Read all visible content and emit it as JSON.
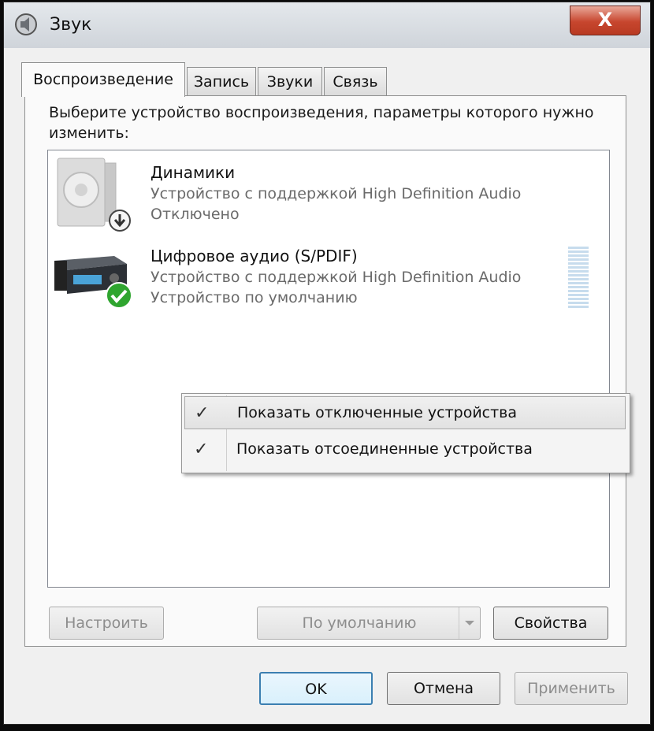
{
  "window": {
    "title": "Звук",
    "close_label": "X"
  },
  "tabs": [
    {
      "label": "Воспроизведение"
    },
    {
      "label": "Запись"
    },
    {
      "label": "Звуки"
    },
    {
      "label": "Связь"
    }
  ],
  "instruction": "Выберите устройство воспроизведения, параметры которого нужно изменить:",
  "devices": [
    {
      "name": "Динамики",
      "description": "Устройство с поддержкой High Definition Audio",
      "status": "Отключено",
      "icon": "speaker-icon",
      "badge": "disabled-arrow-icon"
    },
    {
      "name": "Цифровое аудио (S/PDIF)",
      "description": "Устройство с поддержкой High Definition Audio",
      "status": "Устройство по умолчанию",
      "icon": "digital-audio-receiver-icon",
      "badge": "default-check-icon"
    }
  ],
  "context_menu": [
    {
      "label": "Показать отключенные устройства",
      "checked": true
    },
    {
      "label": "Показать отсоединенные устройства",
      "checked": true
    }
  ],
  "panel_buttons": {
    "configure": "Настроить",
    "set_default": "По умолчанию",
    "properties": "Свойства"
  },
  "dialog_buttons": {
    "ok": "OK",
    "cancel": "Отмена",
    "apply": "Применить"
  },
  "icons": {
    "check_glyph": "✓"
  },
  "colors": {
    "ok_border": "#3c7fb1",
    "close_red": "#c7462e",
    "default_green": "#2fa52f"
  }
}
